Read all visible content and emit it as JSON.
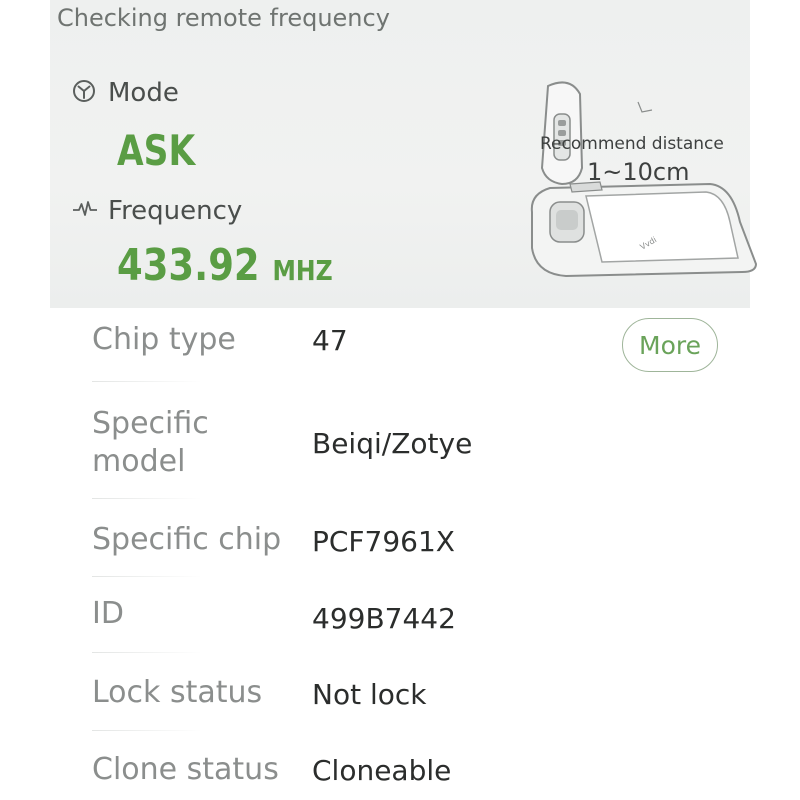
{
  "panel": {
    "title": "Checking remote frequency",
    "mode_label": "Mode",
    "mode_value": "ASK",
    "frequency_label": "Frequency",
    "frequency_value": "433.92",
    "frequency_unit": "MHZ",
    "recommend_label": "Recommend distance",
    "recommend_value": "1~10cm",
    "icons": {
      "mode": "mode-icon",
      "frequency": "waveform-icon"
    },
    "accent_color": "#5a9d44"
  },
  "info": {
    "chip_type_label": "Chip type",
    "chip_type_value": "47",
    "more_label": "More",
    "specific_model_label_line1": "Specific",
    "specific_model_label_line2": "model",
    "specific_model_value": "Beiqi/Zotye",
    "specific_chip_label": "Specific chip",
    "specific_chip_value": "PCF7961X",
    "id_label": "ID",
    "id_value": "499B7442",
    "lock_status_label": "Lock status",
    "lock_status_value": "Not lock",
    "clone_status_label": "Clone status",
    "clone_status_value": "Cloneable"
  }
}
